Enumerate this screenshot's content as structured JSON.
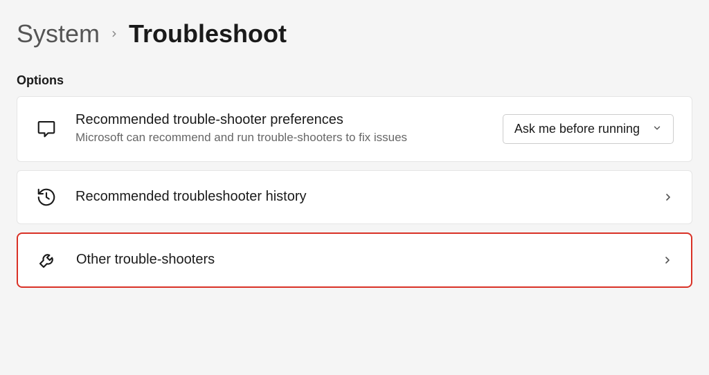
{
  "breadcrumb": {
    "parent": "System",
    "current": "Troubleshoot"
  },
  "section_header": "Options",
  "cards": {
    "preferences": {
      "title": "Recommended trouble-shooter preferences",
      "desc": "Microsoft can recommend and run trouble-shooters to fix issues",
      "dropdown_value": "Ask me before running"
    },
    "history": {
      "title": "Recommended troubleshooter history"
    },
    "other": {
      "title": "Other trouble-shooters"
    }
  }
}
